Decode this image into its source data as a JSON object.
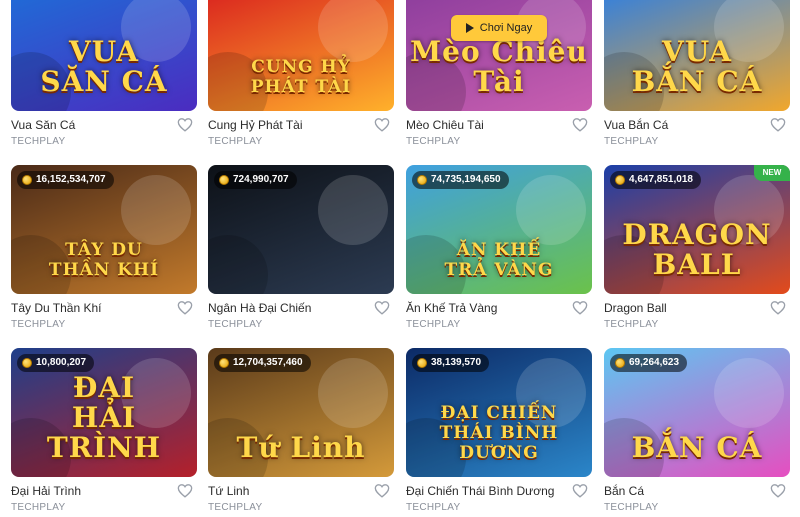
{
  "play_label": "Chơi Ngay",
  "new_label": "NEW",
  "games": [
    {
      "name": "Vua Săn Cá",
      "provider": "TECHPLAY",
      "jackpot": "",
      "art": "VUA\nSĂN CÁ",
      "colors": [
        "#1d6fd8",
        "#4b2cc0"
      ]
    },
    {
      "name": "Cung Hỷ Phát Tài",
      "provider": "TECHPLAY",
      "jackpot": "",
      "art": "CUNG HỶ\nPHÁT TÀI",
      "colors": [
        "#d81e1e",
        "#ffb12b"
      ]
    },
    {
      "name": "Mèo Chiêu Tài",
      "provider": "TECHPLAY",
      "jackpot": "",
      "art": "Mèo Chiêu Tài",
      "colors": [
        "#8a3c9c",
        "#c95fb0"
      ]
    },
    {
      "name": "Vua Bắn Cá",
      "provider": "TECHPLAY",
      "jackpot": "",
      "art": "VUA\nBẮN CÁ",
      "colors": [
        "#2a7ee6",
        "#f1a72c"
      ]
    },
    {
      "name": "Tây Du Thần Khí",
      "provider": "TECHPLAY",
      "jackpot": "16,152,534,707",
      "art": "TÂY DU\nTHẦN KHÍ",
      "colors": [
        "#4a2a18",
        "#c27a2b"
      ]
    },
    {
      "name": "Ngân Hà Đại Chiến",
      "provider": "TECHPLAY",
      "jackpot": "724,990,707",
      "art": "",
      "colors": [
        "#0d1117",
        "#2c3b52"
      ]
    },
    {
      "name": "Ăn Khế Trả Vàng",
      "provider": "TECHPLAY",
      "jackpot": "74,735,194,650",
      "art": "ĂN KHẾ\nTRẢ VÀNG",
      "colors": [
        "#3fa0e0",
        "#6bc24a"
      ]
    },
    {
      "name": "Dragon Ball",
      "provider": "TECHPLAY",
      "jackpot": "4,647,851,018",
      "art": "DRAGON BALL",
      "colors": [
        "#1b3fa8",
        "#e34b1b"
      ],
      "is_new": true
    },
    {
      "name": "Đại Hải Trình",
      "provider": "TECHPLAY",
      "jackpot": "10,800,207",
      "art": "ĐẠI\nHẢI TRÌNH",
      "colors": [
        "#1e3f8a",
        "#b5202a"
      ]
    },
    {
      "name": "Tứ Linh",
      "provider": "TECHPLAY",
      "jackpot": "12,704,357,460",
      "art": "Tứ Linh",
      "colors": [
        "#5a3a1a",
        "#d49a3a"
      ]
    },
    {
      "name": "Đại Chiến Thái Bình Dương",
      "provider": "TECHPLAY",
      "jackpot": "38,139,570",
      "art": "ĐẠI CHIẾN\nTHÁI BÌNH DƯƠNG",
      "colors": [
        "#0c2a66",
        "#2b86c9"
      ]
    },
    {
      "name": "Bắn Cá",
      "provider": "TECHPLAY",
      "jackpot": "69,264,623",
      "art": "BẮN CÁ",
      "colors": [
        "#5cc7f2",
        "#e64ec0"
      ]
    }
  ]
}
